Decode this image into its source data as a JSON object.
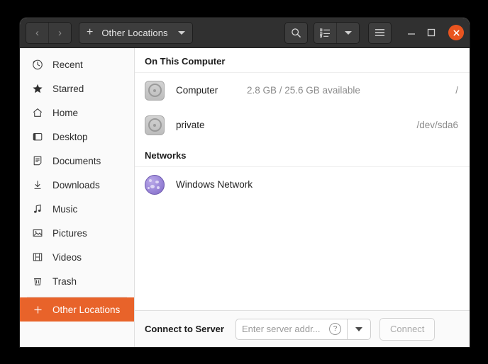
{
  "window": {
    "header": {
      "nav_back": "‹",
      "nav_forward": "›",
      "path_plus": "+",
      "path_label": "Other Locations",
      "search_icon": "search-icon",
      "view_icon": "list-view-icon",
      "view_caret": "chevron-down-icon",
      "menu_icon": "hamburger-menu-icon",
      "minimize": "–",
      "maximize": "□",
      "close": "✕",
      "close_color": "#e9541f",
      "bar_color": "#303030"
    },
    "sidebar": {
      "items": [
        {
          "label": "Recent",
          "icon": "clock-icon",
          "active": false
        },
        {
          "label": "Starred",
          "icon": "star-icon",
          "active": false
        },
        {
          "label": "Home",
          "icon": "home-icon",
          "active": false
        },
        {
          "label": "Desktop",
          "icon": "desktop-icon",
          "active": false
        },
        {
          "label": "Documents",
          "icon": "documents-icon",
          "active": false
        },
        {
          "label": "Downloads",
          "icon": "download-icon",
          "active": false
        },
        {
          "label": "Music",
          "icon": "music-note-icon",
          "active": false
        },
        {
          "label": "Pictures",
          "icon": "picture-icon",
          "active": false
        },
        {
          "label": "Videos",
          "icon": "film-icon",
          "active": false
        },
        {
          "label": "Trash",
          "icon": "trash-icon",
          "active": false
        },
        {
          "label": "Other Locations",
          "icon": "plus-icon",
          "active": true
        }
      ],
      "active_color": "#e8632a"
    },
    "content": {
      "sections": [
        {
          "title": "On This Computer",
          "rows": [
            {
              "name": "Computer",
              "info": "2.8 GB / 25.6 GB available",
              "device": "/",
              "icon": "disk-icon"
            },
            {
              "name": "private",
              "info": "",
              "device": "/dev/sda6",
              "icon": "disk-icon"
            }
          ]
        },
        {
          "title": "Networks",
          "rows": [
            {
              "name": "Windows Network",
              "info": "",
              "device": "",
              "icon": "globe-icon"
            }
          ]
        }
      ]
    },
    "connect_bar": {
      "label": "Connect to Server",
      "input_value": "",
      "input_placeholder": "Enter server addr...",
      "help_icon": "question-mark-icon",
      "dropdown_icon": "chevron-down-icon",
      "connect_label": "Connect"
    }
  }
}
